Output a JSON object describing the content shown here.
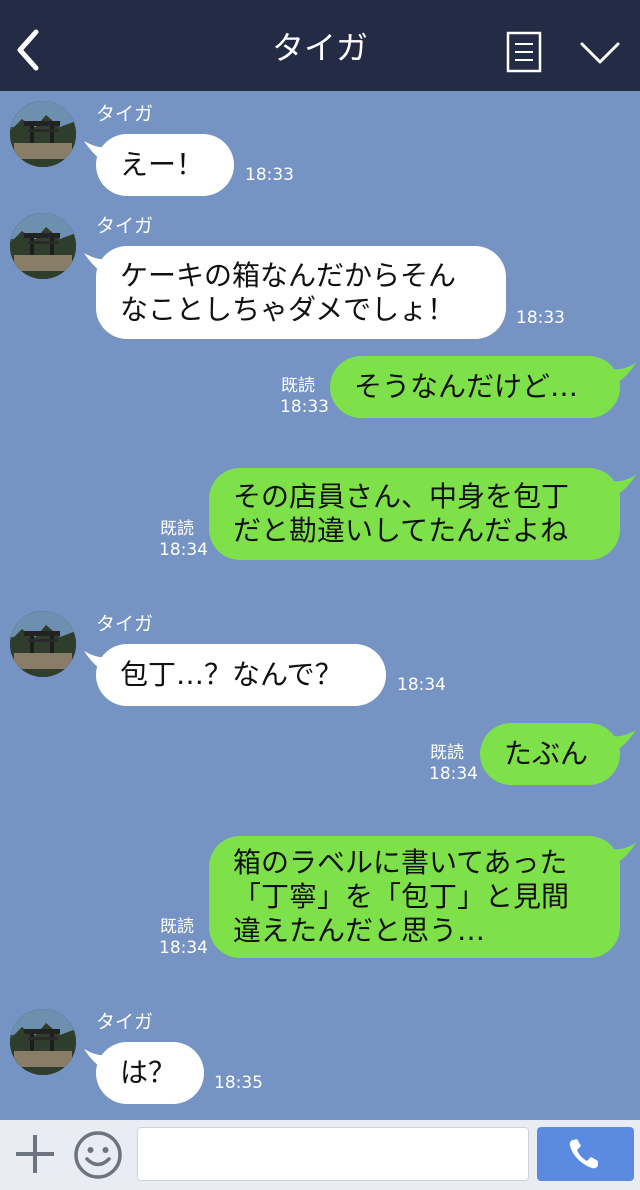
{
  "header": {
    "title": "タイガ"
  },
  "messages": [
    {
      "side": "in",
      "name": "タイガ",
      "lines": [
        "えー！"
      ],
      "time": "18:33"
    },
    {
      "side": "in",
      "name": "タイガ",
      "lines": [
        "ケーキの箱なんだからそん",
        "なことしちゃダメでしょ！"
      ],
      "time": "18:33"
    },
    {
      "side": "out",
      "read": "既読",
      "lines": [
        "そうなんだけど…"
      ],
      "time": "18:33"
    },
    {
      "side": "out",
      "read": "既読",
      "lines": [
        "その店員さん、中身を包丁",
        "だと勘違いしてたんだよね"
      ],
      "time": "18:34"
    },
    {
      "side": "in",
      "name": "タイガ",
      "lines": [
        "包丁…？なんで？"
      ],
      "time": "18:34"
    },
    {
      "side": "out",
      "read": "既読",
      "lines": [
        "たぶん"
      ],
      "time": "18:34"
    },
    {
      "side": "out",
      "read": "既読",
      "lines": [
        "箱のラベルに書いてあった",
        "「丁寧」を「包丁」と見間",
        "違えたんだと思う…"
      ],
      "time": "18:34"
    },
    {
      "side": "in",
      "name": "タイガ",
      "lines": [
        "は？"
      ],
      "time": "18:35"
    }
  ],
  "input": {
    "placeholder": ""
  },
  "colors": {
    "header": "#232b45",
    "background": "#7594c3",
    "outgoing": "#7ee14a",
    "incoming": "#ffffff",
    "send": "#5a8be0"
  },
  "icons": {
    "back": "chevron-left-icon",
    "menu": "menu-list-icon",
    "collapse": "chevron-down-icon",
    "plus": "plus-icon",
    "emoji": "smiley-icon",
    "call": "phone-icon"
  }
}
